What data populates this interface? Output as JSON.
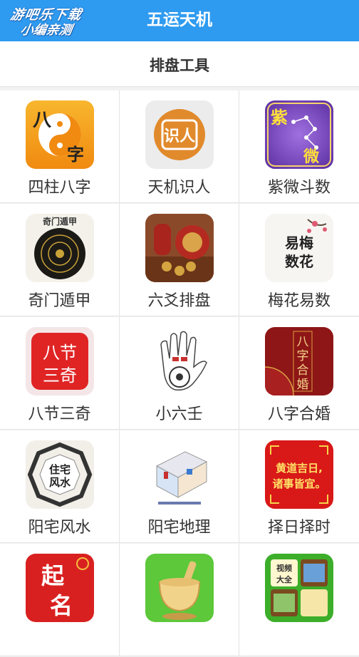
{
  "header": {
    "title": "五运天机"
  },
  "watermark": {
    "line1": "游吧乐下载",
    "line2": "小编亲测"
  },
  "section": {
    "label": "排盘工具"
  },
  "tools": [
    {
      "name": "四柱八字",
      "icon": "bazi-yinyang-icon",
      "glyphs": [
        "八",
        "字"
      ]
    },
    {
      "name": "天机识人",
      "icon": "shiren-seal-icon",
      "glyphs": [
        "识人"
      ]
    },
    {
      "name": "紫微斗数",
      "icon": "ziwei-stars-icon",
      "glyphs": [
        "紫",
        "微"
      ]
    },
    {
      "name": "奇门遁甲",
      "icon": "qimen-compass-icon",
      "glyphs": [
        "奇门遁甲"
      ]
    },
    {
      "name": "六爻排盘",
      "icon": "liuyao-coins-icon",
      "glyphs": []
    },
    {
      "name": "梅花易数",
      "icon": "plum-blossom-icon",
      "glyphs": [
        "易梅",
        "数花"
      ]
    },
    {
      "name": "八节三奇",
      "icon": "bajie-seal-icon",
      "glyphs": [
        "八节",
        "三奇"
      ]
    },
    {
      "name": "小六壬",
      "icon": "palm-hand-icon",
      "glyphs": []
    },
    {
      "name": "八字合婚",
      "icon": "marriage-icon",
      "glyphs": [
        "八",
        "字",
        "合",
        "婚"
      ]
    },
    {
      "name": "阳宅风水",
      "icon": "bagua-icon",
      "glyphs": [
        "住宅",
        "风水"
      ]
    },
    {
      "name": "阳宅地理",
      "icon": "house-layout-icon",
      "glyphs": []
    },
    {
      "name": "择日择时",
      "icon": "lucky-day-icon",
      "glyphs": [
        "黄道吉日,",
        "诸事皆宜。"
      ]
    },
    {
      "name": "",
      "icon": "qiming-icon",
      "glyphs": [
        "起",
        "名"
      ]
    },
    {
      "name": "",
      "icon": "mortar-icon",
      "glyphs": []
    },
    {
      "name": "",
      "icon": "video-collection-icon",
      "glyphs": [
        "视频",
        "大全"
      ]
    }
  ],
  "colors": {
    "topbar": "#2f9bf0",
    "accent_red": "#d92a2a",
    "accent_orange": "#f6a21a"
  }
}
